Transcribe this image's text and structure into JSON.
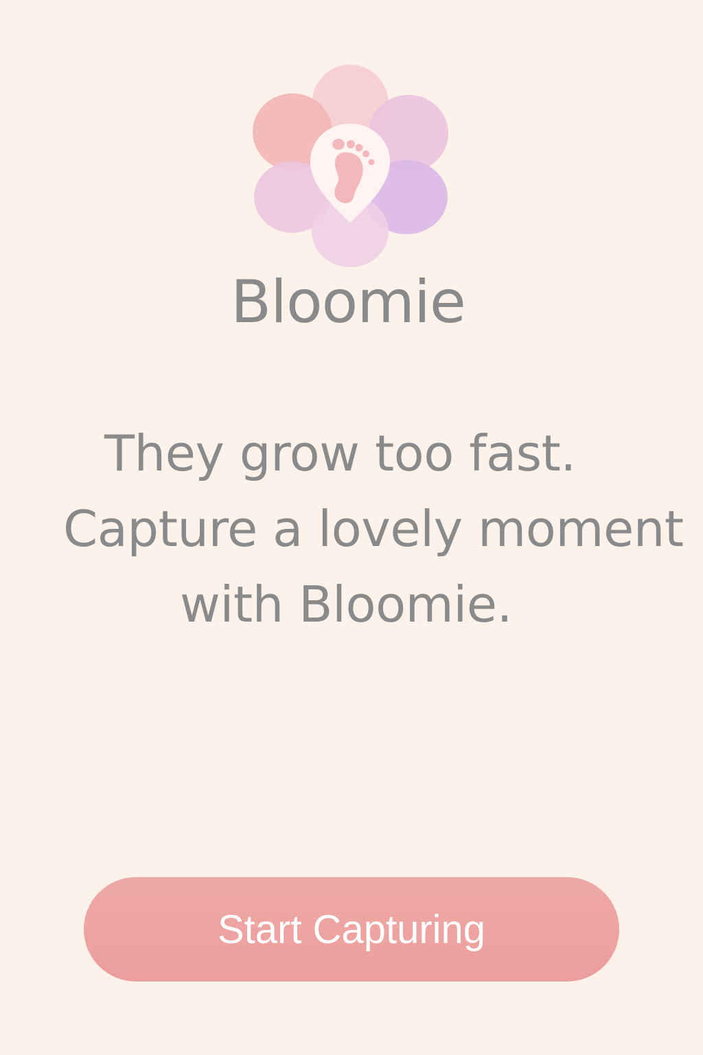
{
  "app": {
    "name": "Bloomie"
  },
  "logo": {
    "icon": "flower-footprint-icon",
    "colors": {
      "petal_pink": "#f3b5b6",
      "petal_light_pink": "#f7cfd0",
      "petal_lilac": "#ebc3df",
      "petal_lavender": "#d9b8e6",
      "center": "#fff4f1",
      "footprint": "#f2b8bb"
    }
  },
  "tagline": {
    "line1": "They grow too fast.",
    "line2": "Capture a lovely moment",
    "line3": "with Bloomie."
  },
  "cta": {
    "label": "Start Capturing",
    "color": "#ec9f9d"
  },
  "theme": {
    "background": "#fcf2ea",
    "text": "#8a8a8a"
  }
}
